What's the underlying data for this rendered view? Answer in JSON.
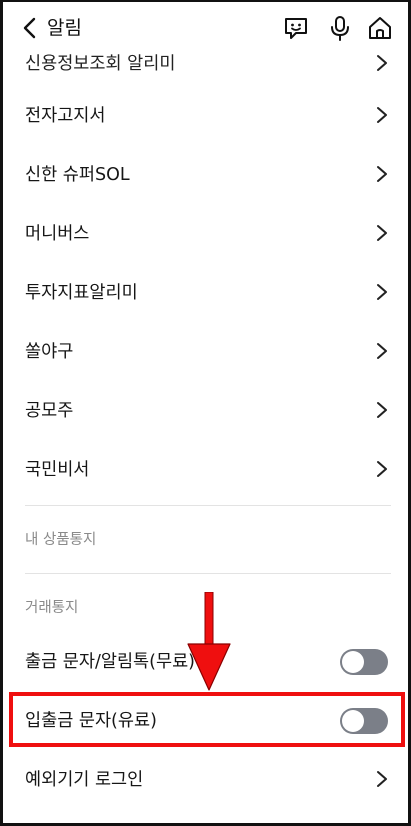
{
  "header": {
    "title": "알림",
    "back_icon": "chevron-left-icon",
    "actions": [
      "chatbot-icon",
      "mic-icon",
      "home-icon"
    ]
  },
  "menu_items": [
    {
      "label": "신용정보조회 알리미"
    },
    {
      "label": "전자고지서"
    },
    {
      "label": "신한 슈퍼SOL"
    },
    {
      "label": "머니버스"
    },
    {
      "label": "투자지표알리미"
    },
    {
      "label": "쏠야구"
    },
    {
      "label": "공모주"
    },
    {
      "label": "국민비서"
    }
  ],
  "sections": {
    "product_notice": "내 상품통지",
    "transaction_notice": "거래통지"
  },
  "toggles": [
    {
      "label": "출금 문자/알림톡(무료)",
      "state": "off"
    },
    {
      "label": "입출금 문자(유료)",
      "state": "off"
    }
  ],
  "last_item": {
    "label": "예외기기 로그인"
  },
  "colors": {
    "toggle_off": "#7b7f88",
    "highlight": "#ef0f0f",
    "divider": "#e3e3e3",
    "section_text": "#8a8a8a"
  }
}
